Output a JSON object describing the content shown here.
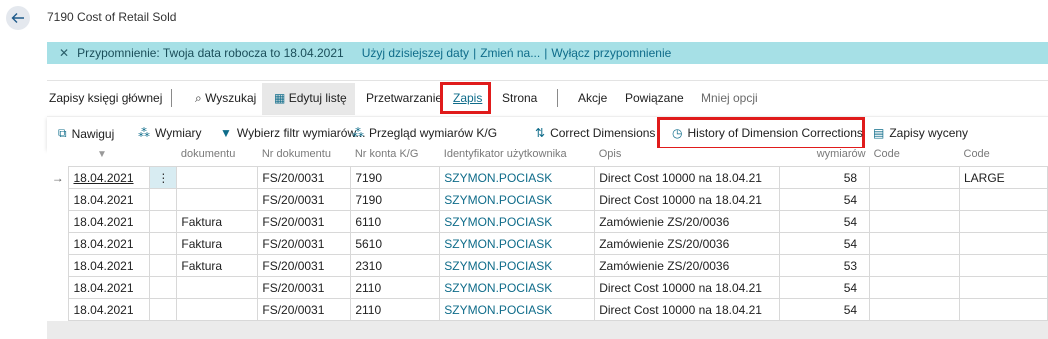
{
  "header": {
    "title": "7190 Cost of Retail Sold"
  },
  "notification": {
    "message": "Przypomnienie: Twoja data robocza to 18.04.2021",
    "use_today": "Użyj dzisiejszej daty",
    "change": "Zmień na...",
    "disable": "Wyłącz przypomnienie",
    "separator": "|"
  },
  "actionbar": {
    "page_caption": "Zapisy księgi głównej",
    "search": "Wyszukaj",
    "edit_list": "Edytuj listę",
    "process": "Przetwarzanie",
    "entry": "Zapis",
    "page": "Strona",
    "actions": "Akcje",
    "related": "Powiązane",
    "fewer_options": "Mniej opcji"
  },
  "subbar": {
    "navigate": "Nawiguj",
    "dimensions": "Wymiary",
    "set_dim_filter": "Wybierz filtr wymiarów...",
    "gl_dim_overview": "Przegląd wymiarów K/G",
    "correct_dimensions": "Correct Dimensions",
    "history_dim_corrections": "History of Dimension Corrections",
    "value_entries": "Zapisy wyceny"
  },
  "table": {
    "headers": {
      "doc_type": "dokumentu",
      "doc_no": "Nr dokumentu",
      "account_no": "Nr konta K/G",
      "user_id": "Identyfikator użytkownika",
      "description": "Opis",
      "dim_set": "wymiarów",
      "code1": "Code",
      "code2": "Code"
    },
    "rows": [
      {
        "date": "18.04.2021",
        "type": "",
        "doc": "FS/20/0031",
        "acc": "7190",
        "user": "SZYMON.POCIASK",
        "desc": "Direct Cost 10000 na 18.04.21",
        "dim": "58",
        "c1": "",
        "c2": "LARGE"
      },
      {
        "date": "18.04.2021",
        "type": "",
        "doc": "FS/20/0031",
        "acc": "7190",
        "user": "SZYMON.POCIASK",
        "desc": "Direct Cost 10000 na 18.04.21",
        "dim": "54",
        "c1": "",
        "c2": ""
      },
      {
        "date": "18.04.2021",
        "type": "Faktura",
        "doc": "FS/20/0031",
        "acc": "6110",
        "user": "SZYMON.POCIASK",
        "desc": "Zamówienie ZS/20/0036",
        "dim": "54",
        "c1": "",
        "c2": ""
      },
      {
        "date": "18.04.2021",
        "type": "Faktura",
        "doc": "FS/20/0031",
        "acc": "5610",
        "user": "SZYMON.POCIASK",
        "desc": "Zamówienie ZS/20/0036",
        "dim": "54",
        "c1": "",
        "c2": ""
      },
      {
        "date": "18.04.2021",
        "type": "Faktura",
        "doc": "FS/20/0031",
        "acc": "2310",
        "user": "SZYMON.POCIASK",
        "desc": "Zamówienie ZS/20/0036",
        "dim": "53",
        "c1": "",
        "c2": ""
      },
      {
        "date": "18.04.2021",
        "type": "",
        "doc": "FS/20/0031",
        "acc": "2110",
        "user": "SZYMON.POCIASK",
        "desc": "Direct Cost 10000 na 18.04.21",
        "dim": "54",
        "c1": "",
        "c2": ""
      },
      {
        "date": "18.04.2021",
        "type": "",
        "doc": "FS/20/0031",
        "acc": "2110",
        "user": "SZYMON.POCIASK",
        "desc": "Direct Cost 10000 na 18.04.21",
        "dim": "54",
        "c1": "",
        "c2": ""
      }
    ]
  },
  "colors": {
    "accent": "#0f6c8a",
    "notification_bg": "#a6e0e6",
    "highlight_box": "#e01b1b"
  },
  "icons": [
    "back-arrow-icon",
    "close-icon",
    "search-icon",
    "edit-list-icon",
    "navigate-icon",
    "dimensions-icon",
    "filter-icon",
    "dimension-overview-icon",
    "correct-dimensions-icon",
    "history-icon",
    "value-entries-icon",
    "row-arrow-icon",
    "ellipsis-icon"
  ]
}
